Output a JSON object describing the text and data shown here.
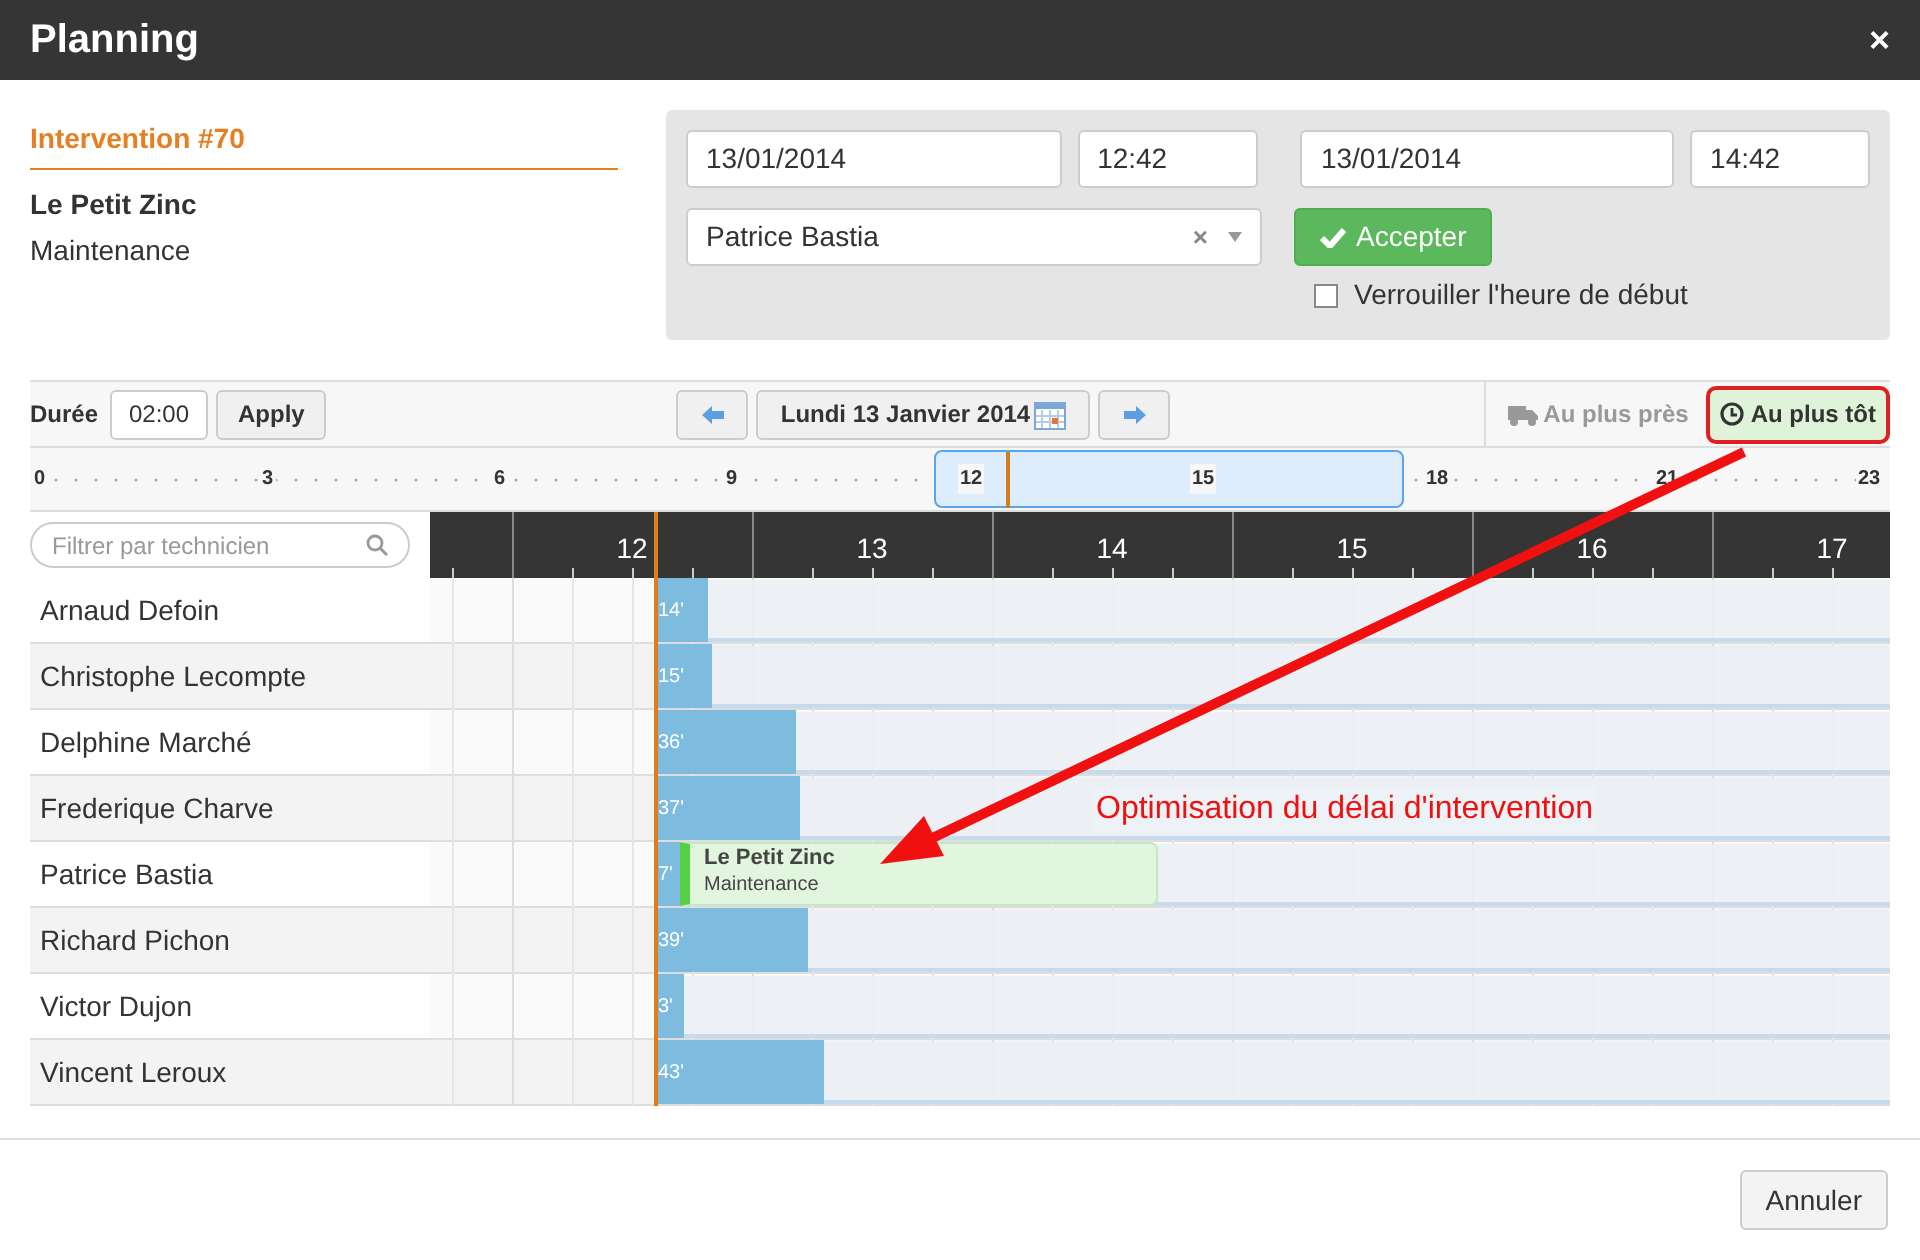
{
  "window": {
    "title": "Planning",
    "close": "×"
  },
  "intervention": {
    "title": "Intervention #70",
    "client": "Le Petit Zinc",
    "type": "Maintenance"
  },
  "form": {
    "start_date": "13/01/2014",
    "start_time": "12:42",
    "end_date": "13/01/2014",
    "end_time": "14:42",
    "technician": "Patrice Bastia",
    "clear": "×",
    "accept": "Accepter",
    "lock_label": "Verrouiller l'heure de début",
    "lock_checked": false
  },
  "toolbar": {
    "duration_label": "Durée",
    "duration": "02:00",
    "apply": "Apply",
    "date": "Lundi 13 Janvier 2014",
    "modes": [
      {
        "label": "Au plus près",
        "kind": "truck",
        "selected": false
      },
      {
        "label": "Au plus tôt",
        "kind": "clock",
        "selected": true
      }
    ]
  },
  "overview": {
    "ticks": [
      "0",
      "3",
      "6",
      "9",
      "12",
      "15",
      "18",
      "21",
      "23"
    ]
  },
  "filter": {
    "placeholder": "Filtrer par technicien"
  },
  "hours": [
    "12",
    "13",
    "14",
    "15",
    "16",
    "17"
  ],
  "technicians": [
    {
      "name": "Arnaud Defoin",
      "travel": "14'",
      "level": 0.042
    },
    {
      "name": "Christophe Lecompte",
      "travel": "15'",
      "level": 0.045
    },
    {
      "name": "Delphine Marché",
      "travel": "36'",
      "level": 0.113
    },
    {
      "name": "Frederique Charve",
      "travel": "37'",
      "level": 0.117
    },
    {
      "name": "Patrice Bastia",
      "travel": "7'",
      "level": 0.019,
      "task": {
        "client": "Le Petit Zinc",
        "type": "Maintenance"
      }
    },
    {
      "name": "Richard Pichon",
      "travel": "39'",
      "level": 0.123
    },
    {
      "name": "Victor Dujon",
      "travel": "3'",
      "level": 0.023
    },
    {
      "name": "Vincent Leroux",
      "travel": "43'",
      "level": 0.136
    }
  ],
  "annotation": "Optimisation du délai d'intervention",
  "footer": {
    "cancel": "Annuler"
  }
}
